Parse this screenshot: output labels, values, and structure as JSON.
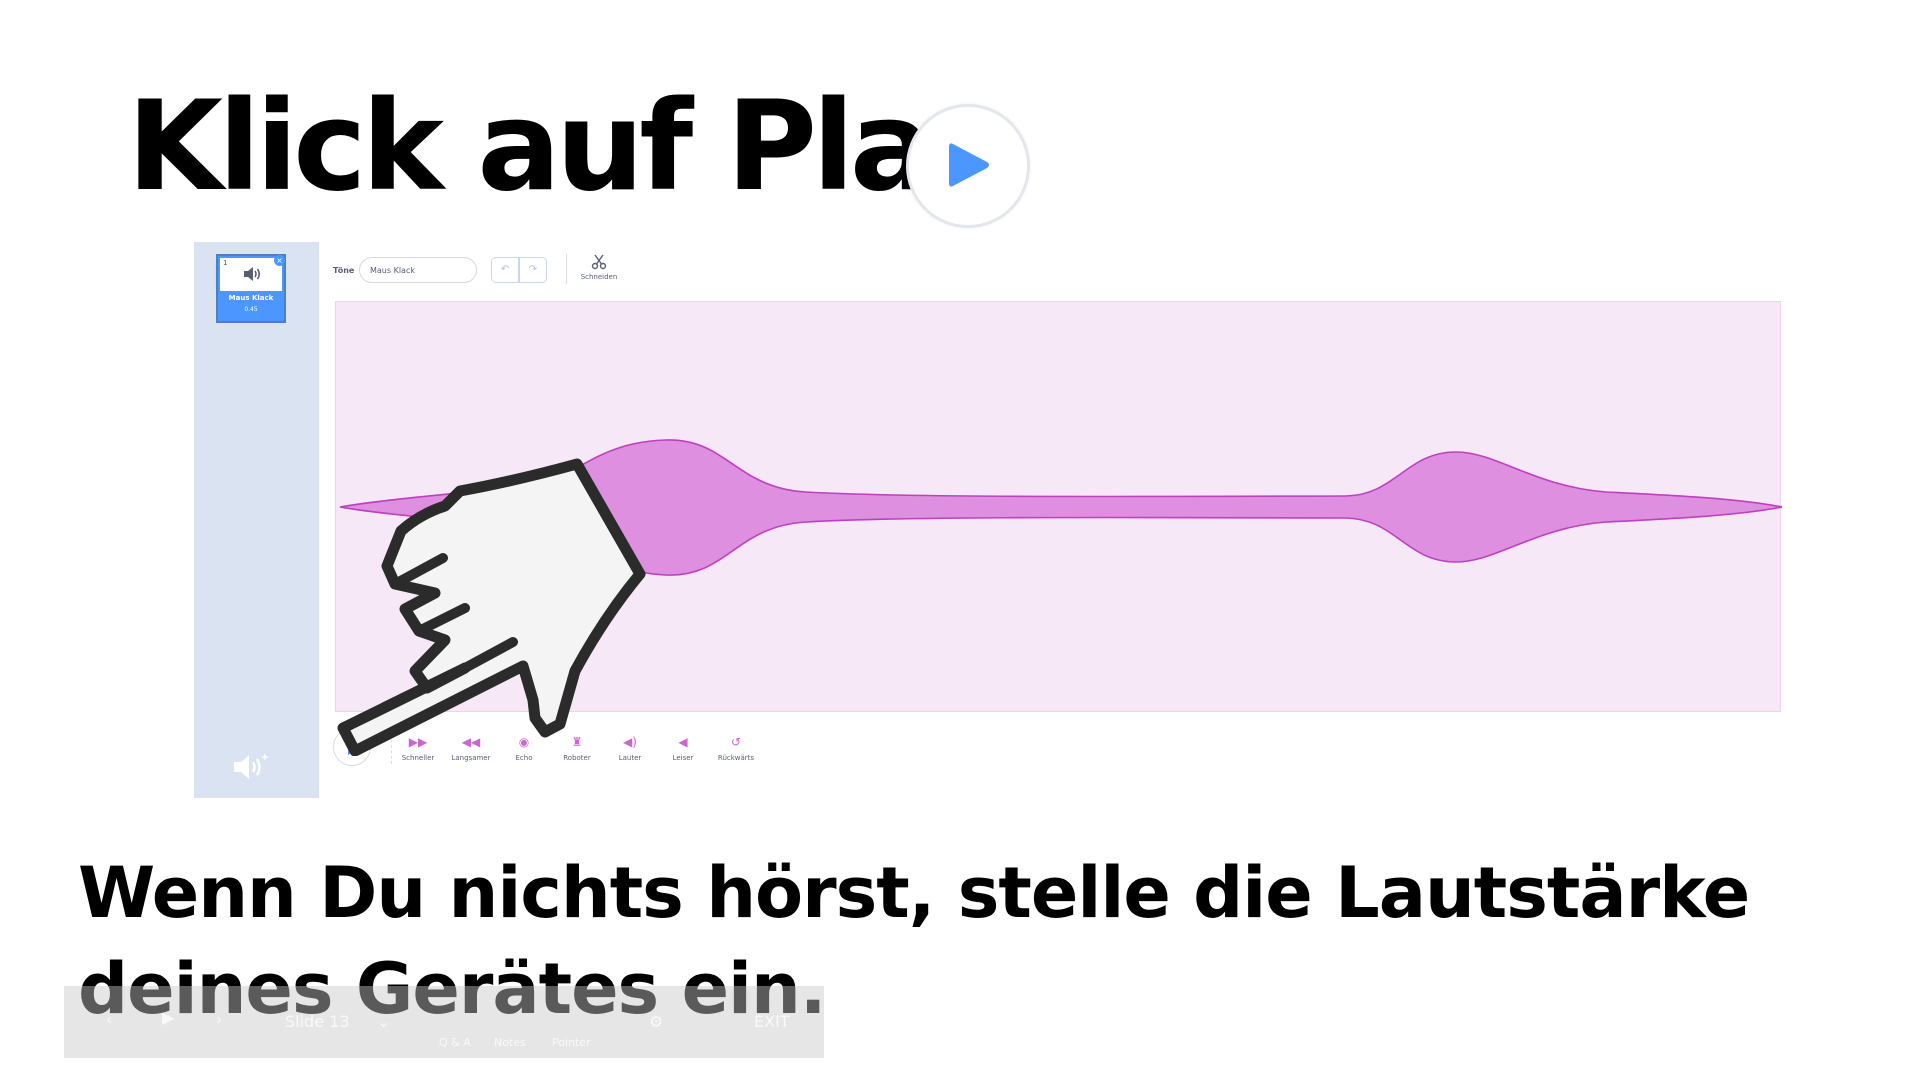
{
  "slide": {
    "title": "Klick auf Play",
    "instruction": "Wenn Du nichts hörst, stelle die Lautstärke deines Gerätes ein."
  },
  "editor": {
    "sound_tile": {
      "number": "1",
      "name": "Maus Klack",
      "length": "0.45"
    },
    "sounds_label": "Töne",
    "sound_name_value": "Maus Klack",
    "cut_label": "Schneiden",
    "effects": [
      {
        "label": "Schneller",
        "icon": "faster-icon"
      },
      {
        "label": "Langsamer",
        "icon": "slower-icon"
      },
      {
        "label": "Echo",
        "icon": "echo-icon"
      },
      {
        "label": "Roboter",
        "icon": "robot-icon"
      },
      {
        "label": "Lauter",
        "icon": "louder-icon"
      },
      {
        "label": "Leiser",
        "icon": "softer-icon"
      },
      {
        "label": "Rückwärts",
        "icon": "reverse-icon"
      }
    ],
    "colors": {
      "accent": "#4c97ff",
      "sound": "#cf63cf",
      "wave_fill": "#de8fe0",
      "panel_bg": "#f7e8f8",
      "sidebar_bg": "#d9e3f2"
    }
  },
  "presenter_bar": {
    "slide_label": "Slide 13",
    "qa_label": "Q & A",
    "notes_label": "Notes",
    "pointer_label": "Pointer",
    "exit_label": "EXIT"
  }
}
